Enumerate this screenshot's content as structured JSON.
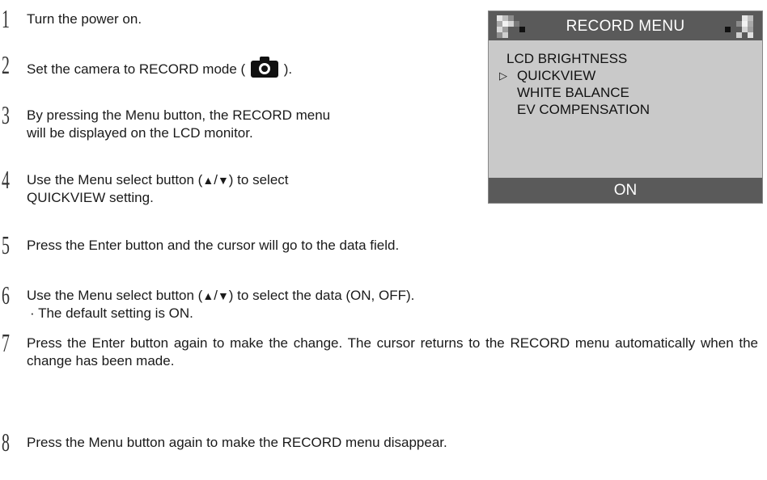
{
  "steps": [
    {
      "num": "1",
      "text": "Turn the power on."
    },
    {
      "num": "2",
      "text_before": "Set the camera to RECORD mode (",
      "text_after": ")."
    },
    {
      "num": "3",
      "line1": "By pressing the Menu button, the RECORD menu",
      "line2": "will be displayed on the LCD monitor."
    },
    {
      "num": "4",
      "line1_before": "Use the Menu select button (",
      "line1_after": ") to select",
      "line2": "QUICKVIEW setting."
    },
    {
      "num": "5",
      "text": "Press the Enter button and the cursor will go to the data field."
    },
    {
      "num": "6",
      "line1_before": "Use the Menu select button (",
      "line1_after": ") to select the data (ON, OFF).",
      "line2": "· The default setting is ON."
    },
    {
      "num": "7",
      "text": "Press the Enter button again to make the change. The cursor returns to the RECORD menu automatically when the change has been made."
    },
    {
      "num": "8",
      "text": "Press the Menu button again to make the RECORD menu disappear."
    }
  ],
  "arrows": {
    "up": "▲",
    "sep": "/",
    "down": "▼"
  },
  "icons": {
    "camera": "camera-icon"
  },
  "lcd": {
    "title": "RECORD MENU",
    "items": [
      "LCD BRIGHTNESS",
      "QUICKVIEW",
      "WHITE BALANCE",
      "EV COMPENSATION"
    ],
    "selected_index": 1,
    "cursor": "▷",
    "value": "ON"
  },
  "colors": {
    "lcd_bar": "#5a5a5a",
    "lcd_screen": "#c9c9c9"
  }
}
